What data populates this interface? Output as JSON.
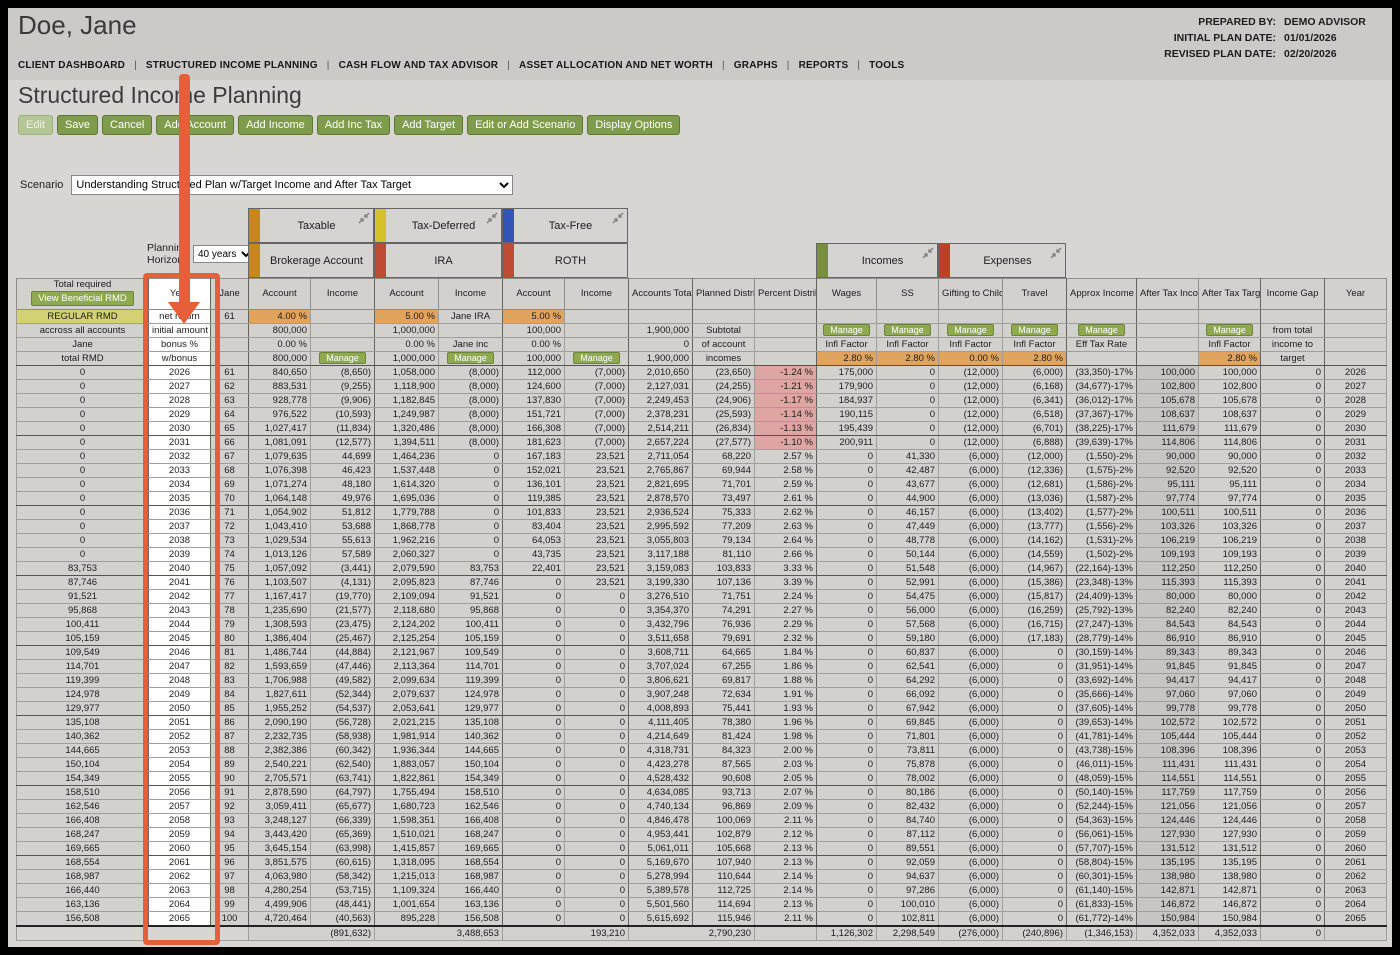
{
  "header": {
    "client_name": "Doe, Jane",
    "prepared_by_label": "PREPARED BY:",
    "prepared_by_value": "DEMO ADVISOR",
    "initial_plan_date_label": "INITIAL PLAN DATE:",
    "initial_plan_date_value": "01/01/2026",
    "revised_plan_date_label": "REVISED PLAN DATE:",
    "revised_plan_date_value": "02/20/2026"
  },
  "nav": {
    "items": [
      "CLIENT DASHBOARD",
      "STRUCTURED INCOME PLANNING",
      "CASH FLOW AND TAX ADVISOR",
      "ASSET ALLOCATION AND NET WORTH",
      "GRAPHS",
      "REPORTS",
      "TOOLS"
    ]
  },
  "page_title": "Structured Income Planning",
  "toolbar": {
    "buttons": [
      {
        "label": "Edit",
        "disabled": true
      },
      {
        "label": "Save"
      },
      {
        "label": "Cancel"
      },
      {
        "label": "Add Account"
      },
      {
        "label": "Add Income"
      },
      {
        "label": "Add Inc Tax"
      },
      {
        "label": "Add Target"
      },
      {
        "label": "Edit or Add Scenario"
      },
      {
        "label": "Display Options"
      }
    ]
  },
  "scenario": {
    "label": "Scenario",
    "selected": "Understanding Structured Plan w/Target Income and After Tax Target"
  },
  "planning_horizon": {
    "label": "Planning Horizon",
    "selected": "40 years"
  },
  "account_groups": {
    "taxable": "Taxable",
    "tax_deferred": "Tax-Deferred",
    "tax_free": "Tax-Free",
    "brokerage": "Brokerage Account",
    "ira": "IRA",
    "roth": "ROTH",
    "incomes": "Incomes",
    "expenses": "Expenses"
  },
  "colors": {
    "accent_orange": "#e65f38",
    "button_green": "#7e9c4b",
    "bar_gold": "#c8871c",
    "bar_yellow": "#d4c22a",
    "bar_blue": "#3355b5",
    "bar_red": "#bf4b32",
    "bar_olive": "#7a8f3d",
    "bar_expense_red": "#bf4028",
    "cell_orange": "#e1a45e",
    "cell_pink": "#dfa5a2",
    "rmd_yellow": "#d3d173"
  },
  "table": {
    "columns": [
      "Total required",
      "Year",
      "Jane",
      "Account",
      "Income",
      "Account",
      "Income",
      "Account",
      "Income",
      "Accounts Total",
      "Planned Distribution",
      "Percent Distribution",
      "Wages",
      "SS",
      "Gifting to Children",
      "Travel",
      "Approx Income Tax",
      "After Tax Income",
      "After Tax Target",
      "Income Gap",
      "Year"
    ],
    "view_rmd_button": "View Beneficial RMD",
    "setup_rows": [
      [
        "REGULAR RMD",
        "net return",
        "61",
        "4.00 %",
        "",
        "5.00 %",
        "Jane IRA",
        "5.00 %",
        "",
        "",
        "",
        "",
        "",
        "",
        "",
        "",
        "",
        "",
        "",
        "",
        ""
      ],
      [
        "accross all accounts",
        "initial amount",
        "",
        "800,000",
        "",
        "1,000,000",
        "",
        "100,000",
        "",
        "1,900,000",
        "Subtotal",
        "",
        "Manage",
        "Manage",
        "Manage",
        "Manage",
        "Manage",
        "",
        "Manage",
        "from total",
        ""
      ],
      [
        "Jane",
        "bonus %",
        "",
        "0.00 %",
        "",
        "0.00 %",
        "Jane inc",
        "0.00 %",
        "",
        "0",
        "of account",
        "",
        "Infl Factor",
        "Infl Factor",
        "Infl Factor",
        "Infl Factor",
        "Eff Tax Rate",
        "",
        "Infl Factor",
        "income to",
        ""
      ],
      [
        "total RMD",
        "w/bonus",
        "",
        "800,000",
        "Manage",
        "1,000,000",
        "Manage",
        "100,000",
        "Manage",
        "1,900,000",
        "incomes",
        "",
        "2.80 %",
        "2.80 %",
        "0.00 %",
        "2.80 %",
        "",
        "",
        "2.80 %",
        "target",
        ""
      ]
    ],
    "rows": [
      [
        "0",
        "2026",
        "61",
        "840,650",
        "(8,650)",
        "1,058,000",
        "(8,000)",
        "112,000",
        "(7,000)",
        "2,010,650",
        "(23,650)",
        "-1.24 %",
        "175,000",
        "0",
        "(12,000)",
        "(6,000)",
        "(33,350)-17%",
        "100,000",
        "100,000",
        "0",
        "2026"
      ],
      [
        "0",
        "2027",
        "62",
        "883,531",
        "(9,255)",
        "1,118,900",
        "(8,000)",
        "124,600",
        "(7,000)",
        "2,127,031",
        "(24,255)",
        "-1.21 %",
        "179,900",
        "0",
        "(12,000)",
        "(6,168)",
        "(34,677)-17%",
        "102,800",
        "102,800",
        "0",
        "2027"
      ],
      [
        "0",
        "2028",
        "63",
        "928,778",
        "(9,906)",
        "1,182,845",
        "(8,000)",
        "137,830",
        "(7,000)",
        "2,249,453",
        "(24,906)",
        "-1.17 %",
        "184,937",
        "0",
        "(12,000)",
        "(6,341)",
        "(36,012)-17%",
        "105,678",
        "105,678",
        "0",
        "2028"
      ],
      [
        "0",
        "2029",
        "64",
        "976,522",
        "(10,593)",
        "1,249,987",
        "(8,000)",
        "151,721",
        "(7,000)",
        "2,378,231",
        "(25,593)",
        "-1.14 %",
        "190,115",
        "0",
        "(12,000)",
        "(6,518)",
        "(37,367)-17%",
        "108,637",
        "108,637",
        "0",
        "2029"
      ],
      [
        "0",
        "2030",
        "65",
        "1,027,417",
        "(11,834)",
        "1,320,486",
        "(8,000)",
        "166,308",
        "(7,000)",
        "2,514,211",
        "(26,834)",
        "-1.13 %",
        "195,439",
        "0",
        "(12,000)",
        "(6,701)",
        "(38,225)-17%",
        "111,679",
        "111,679",
        "0",
        "2030"
      ],
      [
        "0",
        "2031",
        "66",
        "1,081,091",
        "(12,577)",
        "1,394,511",
        "(8,000)",
        "181,623",
        "(7,000)",
        "2,657,224",
        "(27,577)",
        "-1.10 %",
        "200,911",
        "0",
        "(12,000)",
        "(6,888)",
        "(39,639)-17%",
        "114,806",
        "114,806",
        "0",
        "2031"
      ],
      [
        "0",
        "2032",
        "67",
        "1,079,635",
        "44,699",
        "1,464,236",
        "0",
        "167,183",
        "23,521",
        "2,711,054",
        "68,220",
        "2.57 %",
        "0",
        "41,330",
        "(6,000)",
        "(12,000)",
        "(1,550)-2%",
        "90,000",
        "90,000",
        "0",
        "2032"
      ],
      [
        "0",
        "2033",
        "68",
        "1,076,398",
        "46,423",
        "1,537,448",
        "0",
        "152,021",
        "23,521",
        "2,765,867",
        "69,944",
        "2.58 %",
        "0",
        "42,487",
        "(6,000)",
        "(12,336)",
        "(1,575)-2%",
        "92,520",
        "92,520",
        "0",
        "2033"
      ],
      [
        "0",
        "2034",
        "69",
        "1,071,274",
        "48,180",
        "1,614,320",
        "0",
        "136,101",
        "23,521",
        "2,821,695",
        "71,701",
        "2.59 %",
        "0",
        "43,677",
        "(6,000)",
        "(12,681)",
        "(1,586)-2%",
        "95,111",
        "95,111",
        "0",
        "2034"
      ],
      [
        "0",
        "2035",
        "70",
        "1,064,148",
        "49,976",
        "1,695,036",
        "0",
        "119,385",
        "23,521",
        "2,878,570",
        "73,497",
        "2.61 %",
        "0",
        "44,900",
        "(6,000)",
        "(13,036)",
        "(1,587)-2%",
        "97,774",
        "97,774",
        "0",
        "2035"
      ],
      [
        "0",
        "2036",
        "71",
        "1,054,902",
        "51,812",
        "1,779,788",
        "0",
        "101,833",
        "23,521",
        "2,936,524",
        "75,333",
        "2.62 %",
        "0",
        "46,157",
        "(6,000)",
        "(13,402)",
        "(1,577)-2%",
        "100,511",
        "100,511",
        "0",
        "2036"
      ],
      [
        "0",
        "2037",
        "72",
        "1,043,410",
        "53,688",
        "1,868,778",
        "0",
        "83,404",
        "23,521",
        "2,995,592",
        "77,209",
        "2.63 %",
        "0",
        "47,449",
        "(6,000)",
        "(13,777)",
        "(1,556)-2%",
        "103,326",
        "103,326",
        "0",
        "2037"
      ],
      [
        "0",
        "2038",
        "73",
        "1,029,534",
        "55,613",
        "1,962,216",
        "0",
        "64,053",
        "23,521",
        "3,055,803",
        "79,134",
        "2.64 %",
        "0",
        "48,778",
        "(6,000)",
        "(14,162)",
        "(1,531)-2%",
        "106,219",
        "106,219",
        "0",
        "2038"
      ],
      [
        "0",
        "2039",
        "74",
        "1,013,126",
        "57,589",
        "2,060,327",
        "0",
        "43,735",
        "23,521",
        "3,117,188",
        "81,110",
        "2.66 %",
        "0",
        "50,144",
        "(6,000)",
        "(14,559)",
        "(1,502)-2%",
        "109,193",
        "109,193",
        "0",
        "2039"
      ],
      [
        "83,753",
        "2040",
        "75",
        "1,057,092",
        "(3,441)",
        "2,079,590",
        "83,753",
        "22,401",
        "23,521",
        "3,159,083",
        "103,833",
        "3.33 %",
        "0",
        "51,548",
        "(6,000)",
        "(14,967)",
        "(22,164)-13%",
        "112,250",
        "112,250",
        "0",
        "2040"
      ],
      [
        "87,746",
        "2041",
        "76",
        "1,103,507",
        "(4,131)",
        "2,095,823",
        "87,746",
        "0",
        "23,521",
        "3,199,330",
        "107,136",
        "3.39 %",
        "0",
        "52,991",
        "(6,000)",
        "(15,386)",
        "(23,348)-13%",
        "115,393",
        "115,393",
        "0",
        "2041"
      ],
      [
        "91,521",
        "2042",
        "77",
        "1,167,417",
        "(19,770)",
        "2,109,094",
        "91,521",
        "0",
        "0",
        "3,276,510",
        "71,751",
        "2.24 %",
        "0",
        "54,475",
        "(6,000)",
        "(15,817)",
        "(24,409)-13%",
        "80,000",
        "80,000",
        "0",
        "2042"
      ],
      [
        "95,868",
        "2043",
        "78",
        "1,235,690",
        "(21,577)",
        "2,118,680",
        "95,868",
        "0",
        "0",
        "3,354,370",
        "74,291",
        "2.27 %",
        "0",
        "56,000",
        "(6,000)",
        "(16,259)",
        "(25,792)-13%",
        "82,240",
        "82,240",
        "0",
        "2043"
      ],
      [
        "100,411",
        "2044",
        "79",
        "1,308,593",
        "(23,475)",
        "2,124,202",
        "100,411",
        "0",
        "0",
        "3,432,796",
        "76,936",
        "2.29 %",
        "0",
        "57,568",
        "(6,000)",
        "(16,715)",
        "(27,247)-13%",
        "84,543",
        "84,543",
        "0",
        "2044"
      ],
      [
        "105,159",
        "2045",
        "80",
        "1,386,404",
        "(25,467)",
        "2,125,254",
        "105,159",
        "0",
        "0",
        "3,511,658",
        "79,691",
        "2.32 %",
        "0",
        "59,180",
        "(6,000)",
        "(17,183)",
        "(28,779)-14%",
        "86,910",
        "86,910",
        "0",
        "2045"
      ],
      [
        "109,549",
        "2046",
        "81",
        "1,486,744",
        "(44,884)",
        "2,121,967",
        "109,549",
        "0",
        "0",
        "3,608,711",
        "64,665",
        "1.84 %",
        "0",
        "60,837",
        "(6,000)",
        "0",
        "(30,159)-14%",
        "89,343",
        "89,343",
        "0",
        "2046"
      ],
      [
        "114,701",
        "2047",
        "82",
        "1,593,659",
        "(47,446)",
        "2,113,364",
        "114,701",
        "0",
        "0",
        "3,707,024",
        "67,255",
        "1.86 %",
        "0",
        "62,541",
        "(6,000)",
        "0",
        "(31,951)-14%",
        "91,845",
        "91,845",
        "0",
        "2047"
      ],
      [
        "119,399",
        "2048",
        "83",
        "1,706,988",
        "(49,582)",
        "2,099,634",
        "119,399",
        "0",
        "0",
        "3,806,621",
        "69,817",
        "1.88 %",
        "0",
        "64,292",
        "(6,000)",
        "0",
        "(33,692)-14%",
        "94,417",
        "94,417",
        "0",
        "2048"
      ],
      [
        "124,978",
        "2049",
        "84",
        "1,827,611",
        "(52,344)",
        "2,079,637",
        "124,978",
        "0",
        "0",
        "3,907,248",
        "72,634",
        "1.91 %",
        "0",
        "66,092",
        "(6,000)",
        "0",
        "(35,666)-14%",
        "97,060",
        "97,060",
        "0",
        "2049"
      ],
      [
        "129,977",
        "2050",
        "85",
        "1,955,252",
        "(54,537)",
        "2,053,641",
        "129,977",
        "0",
        "0",
        "4,008,893",
        "75,441",
        "1.93 %",
        "0",
        "67,942",
        "(6,000)",
        "0",
        "(37,605)-14%",
        "99,778",
        "99,778",
        "0",
        "2050"
      ],
      [
        "135,108",
        "2051",
        "86",
        "2,090,190",
        "(56,728)",
        "2,021,215",
        "135,108",
        "0",
        "0",
        "4,111,405",
        "78,380",
        "1.96 %",
        "0",
        "69,845",
        "(6,000)",
        "0",
        "(39,653)-14%",
        "102,572",
        "102,572",
        "0",
        "2051"
      ],
      [
        "140,362",
        "2052",
        "87",
        "2,232,735",
        "(58,938)",
        "1,981,914",
        "140,362",
        "0",
        "0",
        "4,214,649",
        "81,424",
        "1.98 %",
        "0",
        "71,801",
        "(6,000)",
        "0",
        "(41,781)-14%",
        "105,444",
        "105,444",
        "0",
        "2052"
      ],
      [
        "144,665",
        "2053",
        "88",
        "2,382,386",
        "(60,342)",
        "1,936,344",
        "144,665",
        "0",
        "0",
        "4,318,731",
        "84,323",
        "2.00 %",
        "0",
        "73,811",
        "(6,000)",
        "0",
        "(43,738)-15%",
        "108,396",
        "108,396",
        "0",
        "2053"
      ],
      [
        "150,104",
        "2054",
        "89",
        "2,540,221",
        "(62,540)",
        "1,883,057",
        "150,104",
        "0",
        "0",
        "4,423,278",
        "87,565",
        "2.03 %",
        "0",
        "75,878",
        "(6,000)",
        "0",
        "(46,011)-15%",
        "111,431",
        "111,431",
        "0",
        "2054"
      ],
      [
        "154,349",
        "2055",
        "90",
        "2,705,571",
        "(63,741)",
        "1,822,861",
        "154,349",
        "0",
        "0",
        "4,528,432",
        "90,608",
        "2.05 %",
        "0",
        "78,002",
        "(6,000)",
        "0",
        "(48,059)-15%",
        "114,551",
        "114,551",
        "0",
        "2055"
      ],
      [
        "158,510",
        "2056",
        "91",
        "2,878,590",
        "(64,797)",
        "1,755,494",
        "158,510",
        "0",
        "0",
        "4,634,085",
        "93,713",
        "2.07 %",
        "0",
        "80,186",
        "(6,000)",
        "0",
        "(50,140)-15%",
        "117,759",
        "117,759",
        "0",
        "2056"
      ],
      [
        "162,546",
        "2057",
        "92",
        "3,059,411",
        "(65,677)",
        "1,680,723",
        "162,546",
        "0",
        "0",
        "4,740,134",
        "96,869",
        "2.09 %",
        "0",
        "82,432",
        "(6,000)",
        "0",
        "(52,244)-15%",
        "121,056",
        "121,056",
        "0",
        "2057"
      ],
      [
        "166,408",
        "2058",
        "93",
        "3,248,127",
        "(66,339)",
        "1,598,351",
        "166,408",
        "0",
        "0",
        "4,846,478",
        "100,069",
        "2.11 %",
        "0",
        "84,740",
        "(6,000)",
        "0",
        "(54,363)-15%",
        "124,446",
        "124,446",
        "0",
        "2058"
      ],
      [
        "168,247",
        "2059",
        "94",
        "3,443,420",
        "(65,369)",
        "1,510,021",
        "168,247",
        "0",
        "0",
        "4,953,441",
        "102,879",
        "2.12 %",
        "0",
        "87,112",
        "(6,000)",
        "0",
        "(56,061)-15%",
        "127,930",
        "127,930",
        "0",
        "2059"
      ],
      [
        "169,665",
        "2060",
        "95",
        "3,645,154",
        "(63,998)",
        "1,415,857",
        "169,665",
        "0",
        "0",
        "5,061,011",
        "105,668",
        "2.13 %",
        "0",
        "89,551",
        "(6,000)",
        "0",
        "(57,707)-15%",
        "131,512",
        "131,512",
        "0",
        "2060"
      ],
      [
        "168,554",
        "2061",
        "96",
        "3,851,575",
        "(60,615)",
        "1,318,095",
        "168,554",
        "0",
        "0",
        "5,169,670",
        "107,940",
        "2.13 %",
        "0",
        "92,059",
        "(6,000)",
        "0",
        "(58,804)-15%",
        "135,195",
        "135,195",
        "0",
        "2061"
      ],
      [
        "168,987",
        "2062",
        "97",
        "4,063,980",
        "(58,342)",
        "1,215,013",
        "168,987",
        "0",
        "0",
        "5,278,994",
        "110,644",
        "2.14 %",
        "0",
        "94,637",
        "(6,000)",
        "0",
        "(60,301)-15%",
        "138,980",
        "138,980",
        "0",
        "2062"
      ],
      [
        "166,440",
        "2063",
        "98",
        "4,280,254",
        "(53,715)",
        "1,109,324",
        "166,440",
        "0",
        "0",
        "5,389,578",
        "112,725",
        "2.14 %",
        "0",
        "97,286",
        "(6,000)",
        "0",
        "(61,140)-15%",
        "142,871",
        "142,871",
        "0",
        "2063"
      ],
      [
        "163,136",
        "2064",
        "99",
        "4,499,906",
        "(48,441)",
        "1,001,654",
        "163,136",
        "0",
        "0",
        "5,501,560",
        "114,694",
        "2.13 %",
        "0",
        "100,010",
        "(6,000)",
        "0",
        "(61,833)-15%",
        "146,872",
        "146,872",
        "0",
        "2064"
      ],
      [
        "156,508",
        "2065",
        "100",
        "4,720,464",
        "(40,563)",
        "895,228",
        "156,508",
        "0",
        "0",
        "5,615,692",
        "115,946",
        "2.11 %",
        "0",
        "102,811",
        "(6,000)",
        "0",
        "(61,772)-14%",
        "150,984",
        "150,984",
        "0",
        "2065"
      ]
    ],
    "totals": {
      "brokerage_income": "(891,632)",
      "ira_income": "3,488,653",
      "roth_income": "193,210",
      "planned_distribution": "2,790,230",
      "wages": "1,126,302",
      "ss": "2,298,549",
      "gifting": "(276,000)",
      "travel": "(240,896)",
      "approx_income_tax": "(1,346,153)",
      "after_tax_income": "4,352,033",
      "after_tax_target": "4,352,033",
      "income_gap": "0"
    }
  }
}
